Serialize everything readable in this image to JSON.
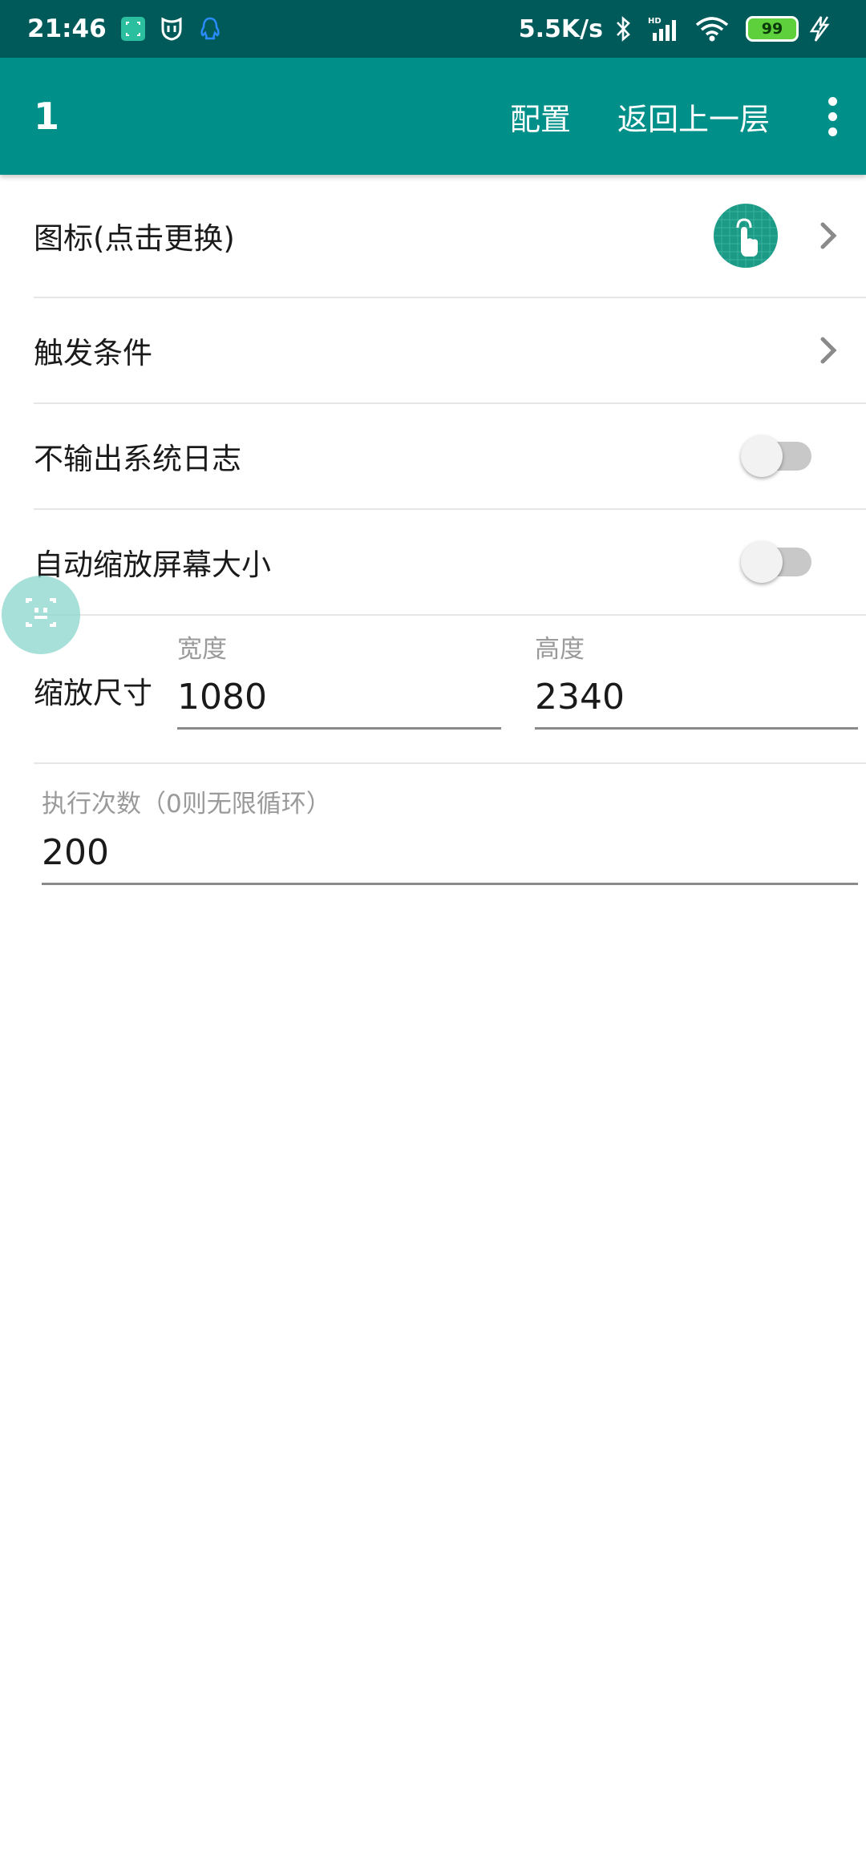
{
  "status_bar": {
    "time": "21:46",
    "net_speed": "5.5K/s",
    "battery": "99",
    "icons": [
      "scan-app-icon",
      "mi-home-icon",
      "qq-icon",
      "bluetooth-icon",
      "hd-signal-icon",
      "wifi-icon",
      "battery-icon",
      "charging-icon"
    ]
  },
  "app_bar": {
    "title": "1",
    "actions": [
      "配置",
      "返回上一层"
    ],
    "overflow_icon": "more-vert-icon"
  },
  "settings": {
    "icon_row": {
      "label": "图标(点击更换)",
      "icon": "touch-hand-icon"
    },
    "trigger_row": {
      "label": "触发条件"
    },
    "no_log_row": {
      "label": "不输出系统日志",
      "enabled": false
    },
    "auto_scale_row": {
      "label": "自动缩放屏幕大小",
      "enabled": false
    },
    "scale_size": {
      "label": "缩放尺寸",
      "width_label": "宽度",
      "width_value": "1080",
      "height_label": "高度",
      "height_value": "2340"
    },
    "exec_count": {
      "label": "执行次数（0则无限循环）",
      "value": "200"
    }
  },
  "colors": {
    "status_bar": "#005a5a",
    "app_bar": "#009089",
    "accent": "#1b9a86"
  }
}
